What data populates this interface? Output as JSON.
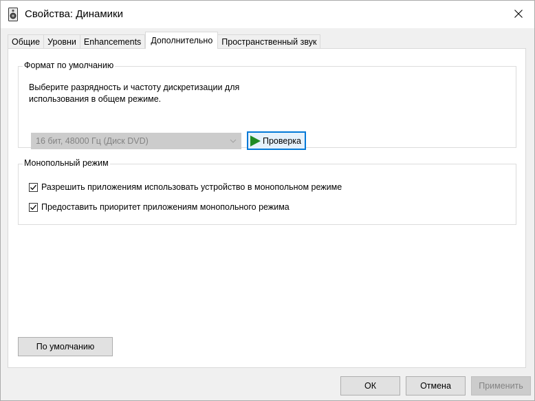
{
  "window": {
    "title": "Свойства: Динамики",
    "icon": "speaker-icon",
    "close_icon": "close-icon"
  },
  "tabs": [
    {
      "label": "Общие",
      "active": false
    },
    {
      "label": "Уровни",
      "active": false
    },
    {
      "label": "Enhancements",
      "active": false
    },
    {
      "label": "Дополнительно",
      "active": true
    },
    {
      "label": "Пространственный звук",
      "active": false
    }
  ],
  "default_format": {
    "group_label": "Формат по умолчанию",
    "description": "Выберите разрядность и частоту дискретизации для использования в общем режиме.",
    "selected_format": "16 бит, 48000 Гц (Диск DVD)",
    "test_button_label": "Проверка"
  },
  "exclusive_mode": {
    "group_label": "Монопольный режим",
    "options": [
      {
        "label": "Разрешить приложениям использовать устройство в монопольном режиме",
        "checked": true
      },
      {
        "label": "Предоставить приоритет приложениям монопольного режима",
        "checked": true
      }
    ]
  },
  "restore_defaults_label": "По умолчанию",
  "footer": {
    "ok_label": "ОК",
    "cancel_label": "Отмена",
    "apply_label": "Применить"
  },
  "colors": {
    "accent": "#0078d7",
    "play_green": "#1f8b24"
  }
}
